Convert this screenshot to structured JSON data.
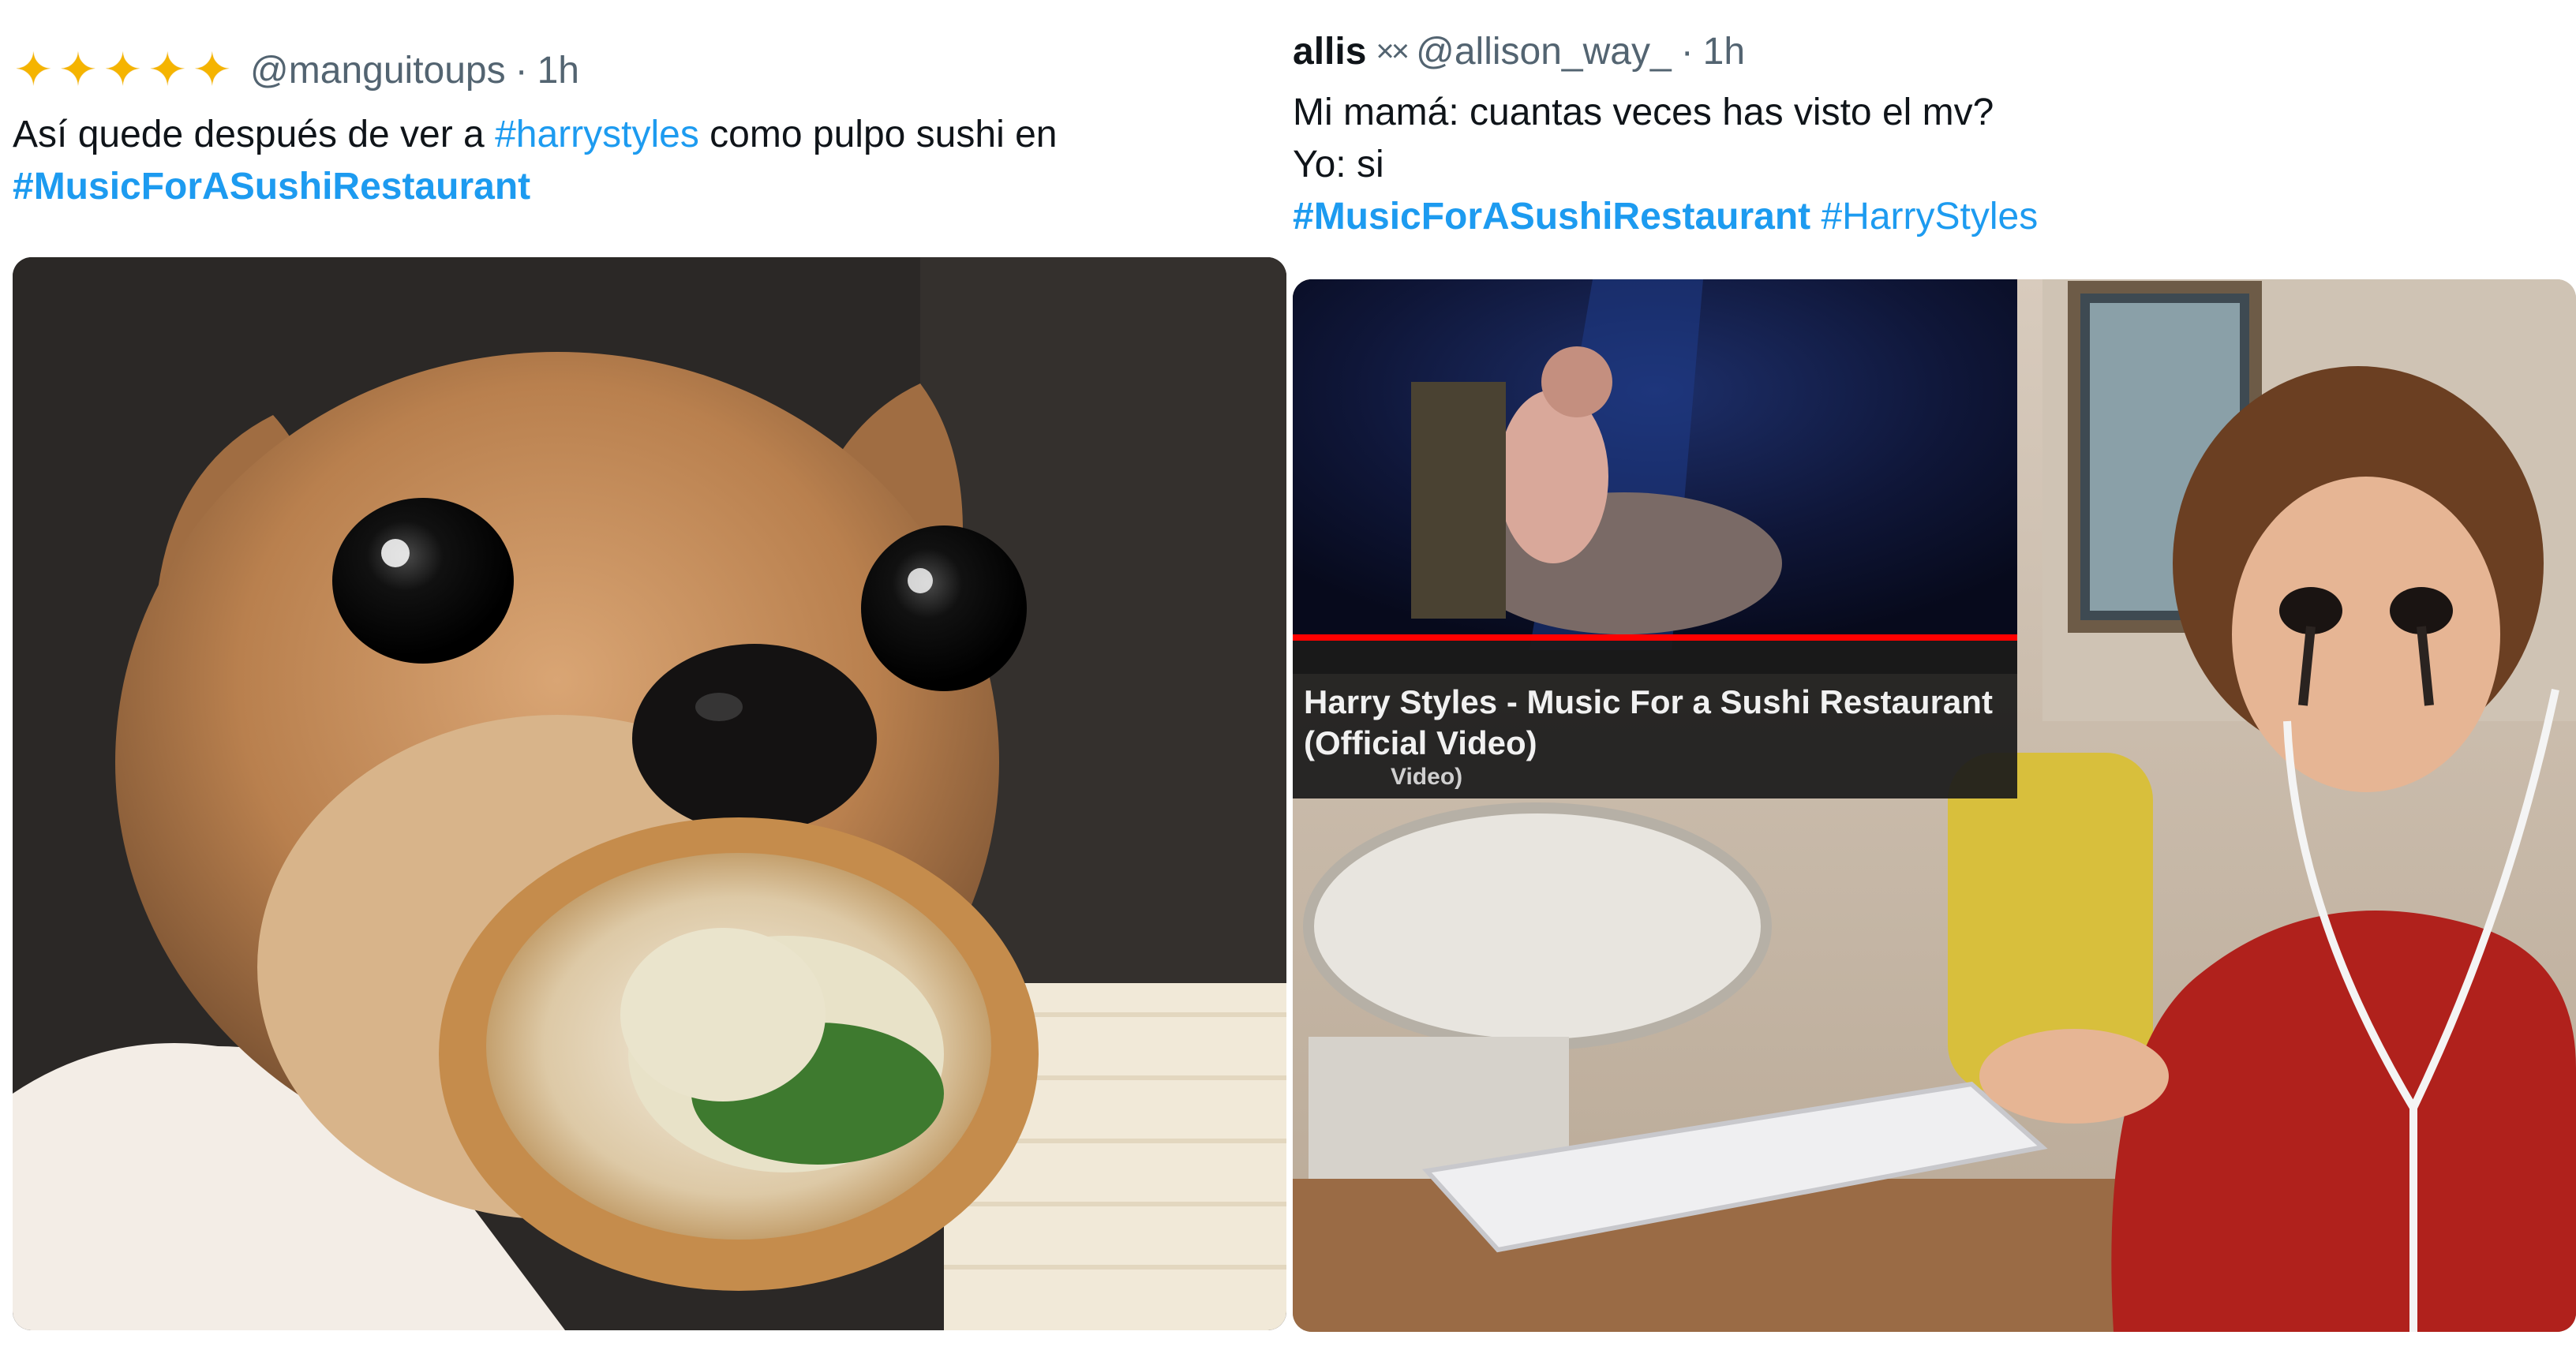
{
  "left_tweet": {
    "name_emoji": "✨✨✨✨✨",
    "handle": "@manguitoups",
    "separator": "·",
    "time": "1h",
    "text_line1_prefix": "Así quede después de ver a ",
    "text_line1_tag": "#harrystyles",
    "text_line1_suffix": " como pulpo sushi en",
    "text_line2_tag": "#MusicForASushiRestaurant",
    "media": {
      "description_icon": "photo-icon"
    }
  },
  "right_tweet": {
    "name": "allis",
    "name_emoji": "××",
    "handle": "@allison_way_",
    "separator": "·",
    "time": "1h",
    "text_line1": "Mi mamá: cuantas veces has visto el mv?",
    "text_line2": "Yo: si",
    "text_line3_tag1": "#MusicForASushiRestaurant",
    "text_line3_tag2": "#HarryStyles",
    "media": {
      "video_title_line1": "Harry Styles - Music For a Sushi Restaurant",
      "video_title_line2": "(Official Video)",
      "video_subtitle": "Video)"
    }
  },
  "colors": {
    "hashtag": "#1d9bf0",
    "secondary_text": "#536471",
    "primary_text": "#0f1419",
    "progress_red": "#ff0000"
  }
}
